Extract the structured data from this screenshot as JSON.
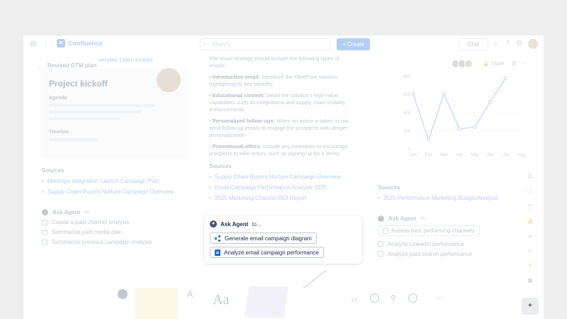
{
  "topbar": {
    "app_name": "Confluence",
    "search_placeholder": "Search",
    "create_label": "+ Create",
    "chat_label": "Chat"
  },
  "left_card": {
    "header_links": "verview  Learn  embed",
    "title": "Revised GTM plan",
    "preview": {
      "title": "Project kickoff",
      "agenda_label": "Agenda",
      "timeline_label": "Timeline"
    },
    "sources_label": "Sources",
    "sources": [
      "Medlogix Integration Launch Campaign Plan",
      "Supply Chain Buyers Nurture Campaign Overview"
    ],
    "ask_agent_label": "Ask Agent",
    "ask_agent_to": "to...",
    "agent_items": [
      "Create a paid channel analysis",
      "Summarize paid media plan",
      "Summarize previous campaign analysis"
    ]
  },
  "middle_card": {
    "intro": "The email strategy should include the following types of emails:",
    "items": [
      {
        "term": "Introduction email:",
        "text": "Introduce the FleetFlow solution, highlighting its key benefits."
      },
      {
        "term": "Educational content:",
        "text": "Detail the solution's high value capabilities such as integrations and supply chain visibility enhancements."
      },
      {
        "term": "Personalized follow-ups:",
        "text": "When an action is taken or not, send follow-up emails to engage the prospects with deeper personalization."
      },
      {
        "term": "Promotional offers:",
        "text": "Include any incentives to encourage prospects to take action, such as signing up for a demo."
      }
    ],
    "sources_label": "Sources",
    "sources": [
      "Supply Chain Buyers Nurture Campaign Overview",
      "Email Campaign Performance Analysis 2025",
      "2025 Marketing Channel ROI Report"
    ]
  },
  "right_card": {
    "share_label": "Share",
    "sources_label": "Sources",
    "sources": [
      "2025 Performance Marketing Budget Analysis"
    ],
    "ask_agent_label": "Ask Agent",
    "ask_agent_to": "to...",
    "agent_items": [
      "Assess best performing channels",
      "Analyze LinkedIn performance",
      "Analyze paid search performance"
    ]
  },
  "chart_data": {
    "type": "line",
    "categories": [
      "Jan",
      "Feb",
      "Mar",
      "Apr",
      "May",
      "Jun",
      "Jul",
      "Aug"
    ],
    "values": [
      610,
      100,
      610,
      220,
      240,
      520,
      780,
      null
    ],
    "ylim": [
      0,
      800
    ],
    "yticks": [
      "0",
      "200",
      "400",
      "600",
      "800"
    ],
    "color": "#5b8def"
  },
  "popup": {
    "title": "Ask Agent",
    "title_suffix": "to...",
    "actions": [
      {
        "label": "Generate email campaign diagram",
        "icon": "diagram-icon"
      },
      {
        "label": "Analyze email campaign performance",
        "icon": "document-icon"
      }
    ]
  }
}
